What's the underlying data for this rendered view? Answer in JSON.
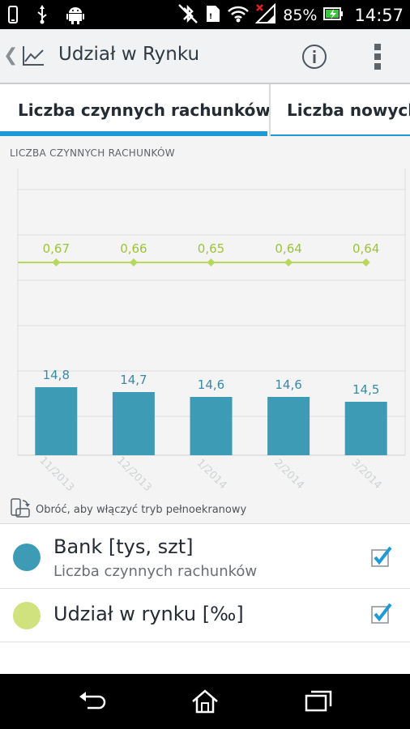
{
  "status_bar": {
    "battery_percent": "85%",
    "time": "14:57",
    "icons": [
      "phone-icon",
      "usb-icon",
      "android-icon",
      "bluetooth-icon",
      "sim-icon",
      "wifi-icon",
      "signal-icon",
      "battery-icon"
    ]
  },
  "action_bar": {
    "title": "Udział w Rynku",
    "icons": [
      "up-caret-icon",
      "chart-trend-icon",
      "info-icon",
      "overflow-menu-icon"
    ]
  },
  "tabs": [
    {
      "label": "Liczba czynnych rachunków",
      "selected": true
    },
    {
      "label": "Liczba nowych",
      "selected": false
    }
  ],
  "chart_header": "LICZBA CZYNNYCH RACHUNKÓW",
  "chart_data": {
    "type": "bar",
    "categories": [
      "11/2013",
      "12/2013",
      "1/2014",
      "2/2014",
      "3/2014"
    ],
    "series": [
      {
        "name": "Bank [tys, szt]",
        "type": "bar",
        "values": [
          14.8,
          14.7,
          14.6,
          14.6,
          14.5
        ],
        "labels": [
          "14,8",
          "14,7",
          "14,6",
          "14,6",
          "14,5"
        ],
        "color": "#3e9bb5"
      },
      {
        "name": "Udział w rynku [‰]",
        "type": "line",
        "values": [
          0.67,
          0.66,
          0.65,
          0.64,
          0.64
        ],
        "labels": [
          "0,67",
          "0,66",
          "0,65",
          "0,64",
          "0,64"
        ],
        "color": "#b8d85a"
      }
    ],
    "grid": true
  },
  "rotate_hint": "Obróć, aby włączyć tryb pełnoekranowy",
  "legend": [
    {
      "title": "Bank [tys, szt]",
      "subtitle": "Liczba czynnych rachunków",
      "color": "#3e9bb5",
      "checked": true
    },
    {
      "title": "Udział w rynku [‰]",
      "color": "#d0e27e",
      "checked": true
    }
  ],
  "nav_bar": {
    "icons": [
      "back-icon",
      "home-icon",
      "recents-icon"
    ]
  },
  "colors": {
    "accent": "#1e9ad6",
    "bar": "#3e9bb5",
    "line": "#b8d85a",
    "check": "#1e9ad6"
  }
}
